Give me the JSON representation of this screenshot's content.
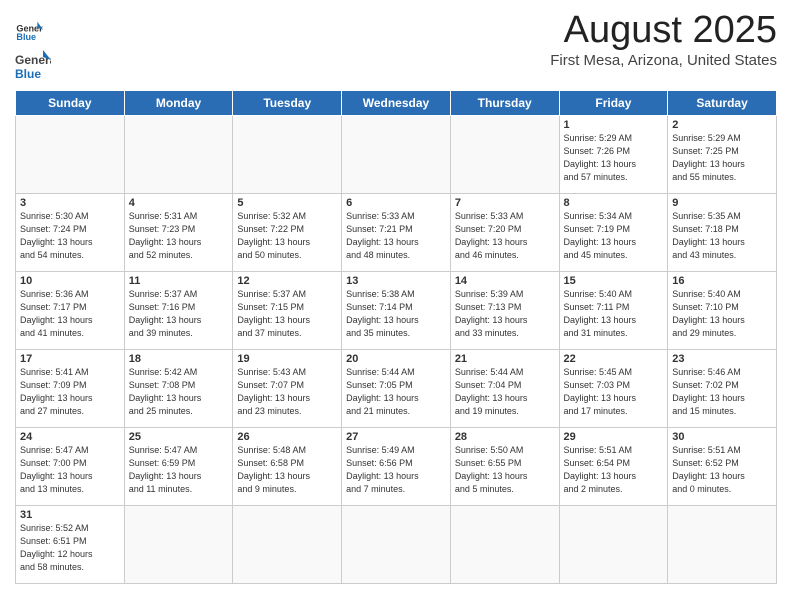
{
  "header": {
    "logo_general": "General",
    "logo_blue": "Blue",
    "title": "August 2025",
    "subtitle": "First Mesa, Arizona, United States"
  },
  "weekdays": [
    "Sunday",
    "Monday",
    "Tuesday",
    "Wednesday",
    "Thursday",
    "Friday",
    "Saturday"
  ],
  "weeks": [
    [
      {
        "day": "",
        "info": ""
      },
      {
        "day": "",
        "info": ""
      },
      {
        "day": "",
        "info": ""
      },
      {
        "day": "",
        "info": ""
      },
      {
        "day": "",
        "info": ""
      },
      {
        "day": "1",
        "info": "Sunrise: 5:29 AM\nSunset: 7:26 PM\nDaylight: 13 hours\nand 57 minutes."
      },
      {
        "day": "2",
        "info": "Sunrise: 5:29 AM\nSunset: 7:25 PM\nDaylight: 13 hours\nand 55 minutes."
      }
    ],
    [
      {
        "day": "3",
        "info": "Sunrise: 5:30 AM\nSunset: 7:24 PM\nDaylight: 13 hours\nand 54 minutes."
      },
      {
        "day": "4",
        "info": "Sunrise: 5:31 AM\nSunset: 7:23 PM\nDaylight: 13 hours\nand 52 minutes."
      },
      {
        "day": "5",
        "info": "Sunrise: 5:32 AM\nSunset: 7:22 PM\nDaylight: 13 hours\nand 50 minutes."
      },
      {
        "day": "6",
        "info": "Sunrise: 5:33 AM\nSunset: 7:21 PM\nDaylight: 13 hours\nand 48 minutes."
      },
      {
        "day": "7",
        "info": "Sunrise: 5:33 AM\nSunset: 7:20 PM\nDaylight: 13 hours\nand 46 minutes."
      },
      {
        "day": "8",
        "info": "Sunrise: 5:34 AM\nSunset: 7:19 PM\nDaylight: 13 hours\nand 45 minutes."
      },
      {
        "day": "9",
        "info": "Sunrise: 5:35 AM\nSunset: 7:18 PM\nDaylight: 13 hours\nand 43 minutes."
      }
    ],
    [
      {
        "day": "10",
        "info": "Sunrise: 5:36 AM\nSunset: 7:17 PM\nDaylight: 13 hours\nand 41 minutes."
      },
      {
        "day": "11",
        "info": "Sunrise: 5:37 AM\nSunset: 7:16 PM\nDaylight: 13 hours\nand 39 minutes."
      },
      {
        "day": "12",
        "info": "Sunrise: 5:37 AM\nSunset: 7:15 PM\nDaylight: 13 hours\nand 37 minutes."
      },
      {
        "day": "13",
        "info": "Sunrise: 5:38 AM\nSunset: 7:14 PM\nDaylight: 13 hours\nand 35 minutes."
      },
      {
        "day": "14",
        "info": "Sunrise: 5:39 AM\nSunset: 7:13 PM\nDaylight: 13 hours\nand 33 minutes."
      },
      {
        "day": "15",
        "info": "Sunrise: 5:40 AM\nSunset: 7:11 PM\nDaylight: 13 hours\nand 31 minutes."
      },
      {
        "day": "16",
        "info": "Sunrise: 5:40 AM\nSunset: 7:10 PM\nDaylight: 13 hours\nand 29 minutes."
      }
    ],
    [
      {
        "day": "17",
        "info": "Sunrise: 5:41 AM\nSunset: 7:09 PM\nDaylight: 13 hours\nand 27 minutes."
      },
      {
        "day": "18",
        "info": "Sunrise: 5:42 AM\nSunset: 7:08 PM\nDaylight: 13 hours\nand 25 minutes."
      },
      {
        "day": "19",
        "info": "Sunrise: 5:43 AM\nSunset: 7:07 PM\nDaylight: 13 hours\nand 23 minutes."
      },
      {
        "day": "20",
        "info": "Sunrise: 5:44 AM\nSunset: 7:05 PM\nDaylight: 13 hours\nand 21 minutes."
      },
      {
        "day": "21",
        "info": "Sunrise: 5:44 AM\nSunset: 7:04 PM\nDaylight: 13 hours\nand 19 minutes."
      },
      {
        "day": "22",
        "info": "Sunrise: 5:45 AM\nSunset: 7:03 PM\nDaylight: 13 hours\nand 17 minutes."
      },
      {
        "day": "23",
        "info": "Sunrise: 5:46 AM\nSunset: 7:02 PM\nDaylight: 13 hours\nand 15 minutes."
      }
    ],
    [
      {
        "day": "24",
        "info": "Sunrise: 5:47 AM\nSunset: 7:00 PM\nDaylight: 13 hours\nand 13 minutes."
      },
      {
        "day": "25",
        "info": "Sunrise: 5:47 AM\nSunset: 6:59 PM\nDaylight: 13 hours\nand 11 minutes."
      },
      {
        "day": "26",
        "info": "Sunrise: 5:48 AM\nSunset: 6:58 PM\nDaylight: 13 hours\nand 9 minutes."
      },
      {
        "day": "27",
        "info": "Sunrise: 5:49 AM\nSunset: 6:56 PM\nDaylight: 13 hours\nand 7 minutes."
      },
      {
        "day": "28",
        "info": "Sunrise: 5:50 AM\nSunset: 6:55 PM\nDaylight: 13 hours\nand 5 minutes."
      },
      {
        "day": "29",
        "info": "Sunrise: 5:51 AM\nSunset: 6:54 PM\nDaylight: 13 hours\nand 2 minutes."
      },
      {
        "day": "30",
        "info": "Sunrise: 5:51 AM\nSunset: 6:52 PM\nDaylight: 13 hours\nand 0 minutes."
      }
    ],
    [
      {
        "day": "31",
        "info": "Sunrise: 5:52 AM\nSunset: 6:51 PM\nDaylight: 12 hours\nand 58 minutes."
      },
      {
        "day": "",
        "info": ""
      },
      {
        "day": "",
        "info": ""
      },
      {
        "day": "",
        "info": ""
      },
      {
        "day": "",
        "info": ""
      },
      {
        "day": "",
        "info": ""
      },
      {
        "day": "",
        "info": ""
      }
    ]
  ]
}
